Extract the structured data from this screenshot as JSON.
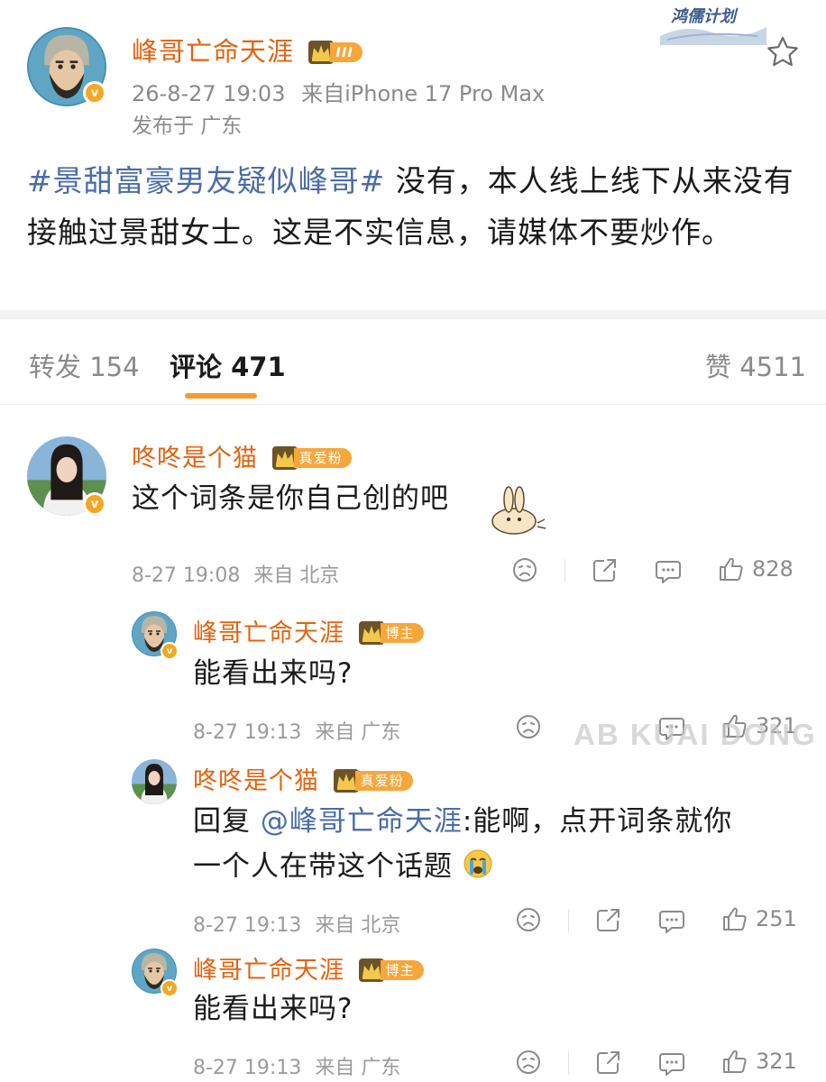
{
  "brand": {
    "logo_text": "鸿儒计划"
  },
  "post": {
    "author": "峰哥亡命天涯",
    "level_badge": "III",
    "time": "26-8-27 19:03",
    "source": "来自iPhone 17 Pro Max",
    "location": "发布于 广东",
    "hashtag": "#景甜富豪男友疑似峰哥#",
    "body": " 没有，本人线上线下从来没有接触过景甜女士。这是不实信息，请媒体不要炒作。"
  },
  "tabs": {
    "repost": "转发 154",
    "comment": "评论 471",
    "like": "赞 4511"
  },
  "comments": [
    {
      "author": "咚咚是个猫",
      "badge": "真爱粉",
      "text": "这个词条是你自己创的吧",
      "time": "8-27 19:08",
      "source": "来自 北京",
      "likes": "828"
    }
  ],
  "replies": [
    {
      "author": "峰哥亡命天涯",
      "badge": "博主",
      "text": "能看出来吗?",
      "time": "8-27 19:13",
      "source": "来自 广东",
      "likes": "321"
    },
    {
      "author": "咚咚是个猫",
      "badge": "真爱粉",
      "reply_prefix": "回复 ",
      "mention": "@峰哥亡命天涯",
      "text_line1": ":能啊，点开词条就你",
      "text_line2": "一个人在带这个话题",
      "time": "8-27 19:13",
      "source": "来自 北京",
      "likes": "251"
    },
    {
      "author": "峰哥亡命天涯",
      "badge": "博主",
      "text": "能看出来吗?",
      "time": "8-27 19:13",
      "source": "来自 广东",
      "likes": "321"
    }
  ],
  "watermark": "AB KUAI DONG",
  "colors": {
    "name": "#e2630f",
    "link": "#4a6ca8",
    "accent": "#f59b2f"
  },
  "icons": [
    "star-icon",
    "dislike-icon",
    "share-icon",
    "comment-icon",
    "like-icon",
    "crown-icon",
    "verified-icon"
  ]
}
